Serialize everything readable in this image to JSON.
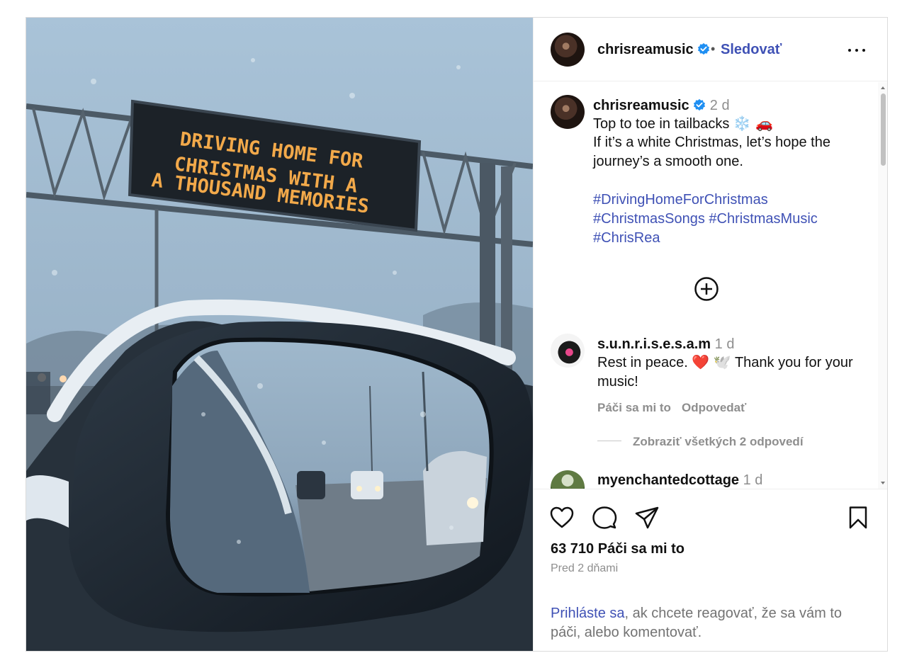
{
  "post": {
    "image": {
      "description_icon": "photo",
      "sign_lines": [
        "DRIVING HOME FOR",
        "CHRISTMAS WITH A",
        "A THOUSAND MEMORIES"
      ]
    },
    "header": {
      "username": "chrisreamusic",
      "separator": "•",
      "follow_label": "Sledovať",
      "more_icon": "more-horizontal-icon"
    },
    "caption": {
      "username": "chrisreamusic",
      "time": "2 d",
      "lines": [
        "Top to toe in tailbacks ",
        "If it’s a white Christmas, let’s hope the",
        "journey’s a smooth one."
      ],
      "emoji": "❄️ 🚗",
      "hashtags": [
        "#DrivingHomeForChristmas",
        "#ChristmasSongs #ChristmasMusic",
        "#ChrisRea"
      ]
    },
    "comments": [
      {
        "username": "s.u.n.r.i.s.e.s.a.m",
        "time": "1 d",
        "text_line1": "Rest in peace. ❤️ 🕊️ Thank you for your",
        "text_line2": "music!",
        "like_label": "Páči sa mi to",
        "reply_label": "Odpovedať",
        "view_replies_label": "Zobraziť všetkých 2 odpovedí"
      },
      {
        "username": "myenchantedcottage",
        "time": "1 d"
      }
    ],
    "actions": {
      "likes": "63 710 Páči sa mi to",
      "posted": "Pred 2 dňami",
      "login_link": "Prihláste sa",
      "login_text": ", ak chcete reagovať, že sa vám to páči, alebo komentovať."
    },
    "colors": {
      "accent": "#3f51b5",
      "verified": "#1f8ff2",
      "muted": "#8e8e8e"
    }
  }
}
